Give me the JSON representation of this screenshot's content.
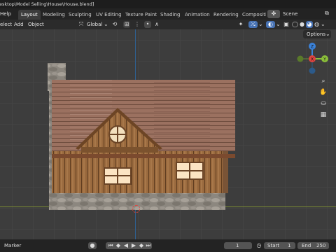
{
  "titlebar": {
    "path": "esktop\\Model Selling\\House\\House.blend]"
  },
  "menubar": {
    "help": "Help",
    "tabs": [
      "Layout",
      "Modeling",
      "Sculpting",
      "UV Editing",
      "Texture Paint",
      "Shading",
      "Animation",
      "Rendering",
      "Compositi"
    ],
    "active_tab": "Layout",
    "scene": "Scene"
  },
  "toolbar": {
    "select": "elect",
    "add": "Add",
    "object": "Object",
    "orientation": "Global"
  },
  "viewport": {
    "options": "Options",
    "gizmo": {
      "z": "Z",
      "x": "X",
      "y": "Y"
    }
  },
  "statusbar": {
    "marker": "Marker",
    "current_frame": "1",
    "start_label": "Start",
    "start_value": "1",
    "end_label": "End",
    "end_value": "250"
  },
  "colors": {
    "accent": "#4772b3",
    "x_axis": "#e0443f",
    "y_axis": "#8bbf3a",
    "z_axis": "#3b82d9"
  }
}
